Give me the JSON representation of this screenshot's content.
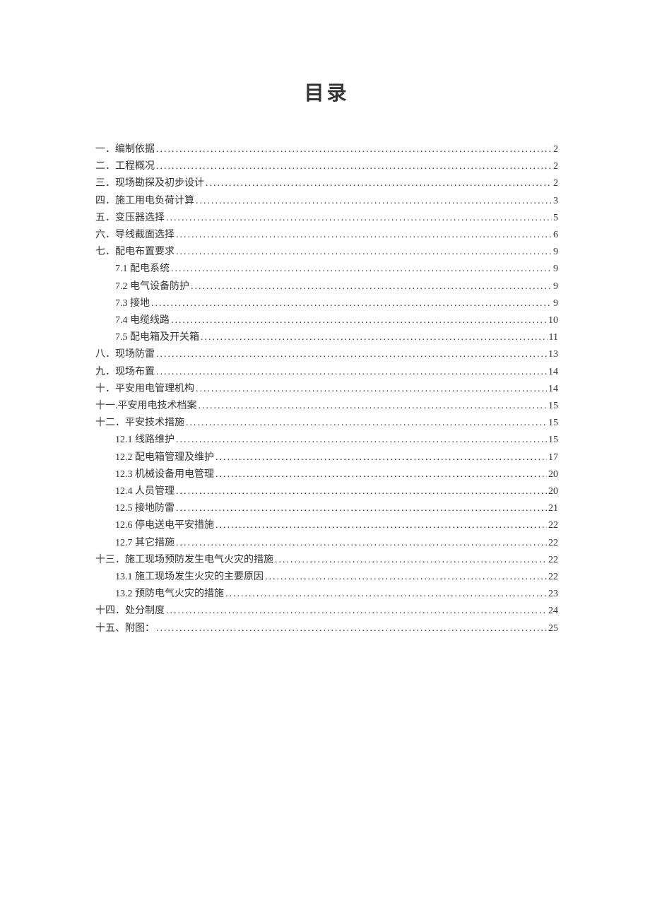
{
  "title": "目录",
  "entries": [
    {
      "label": "一．编制依据 ",
      "page": "2",
      "sub": false
    },
    {
      "label": "二．工程概况 ",
      "page": "2",
      "sub": false
    },
    {
      "label": "三．现场勘探及初步设计 ",
      "page": "2",
      "sub": false
    },
    {
      "label": "四．施工用电负荷计算 ",
      "page": "3",
      "sub": false
    },
    {
      "label": "五．变压器选择 ",
      "page": "5",
      "sub": false
    },
    {
      "label": "六．导线截面选择 ",
      "page": "6",
      "sub": false
    },
    {
      "label": "七．配电布置要求 ",
      "page": "9",
      "sub": false
    },
    {
      "label": "7.1 配电系统 ",
      "page": "9",
      "sub": true
    },
    {
      "label": "7.2 电气设备防护 ",
      "page": "9",
      "sub": true
    },
    {
      "label": "7.3 接地 ",
      "page": "9",
      "sub": true
    },
    {
      "label": "7.4 电缆线路 ",
      "page": "10",
      "sub": true
    },
    {
      "label": "7.5 配电箱及开关箱 ",
      "page": "11",
      "sub": true
    },
    {
      "label": "八．现场防雷 ",
      "page": "13",
      "sub": false
    },
    {
      "label": "九．现场布置 ",
      "page": "14",
      "sub": false
    },
    {
      "label": "十．平安用电管理机构 ",
      "page": "14",
      "sub": false
    },
    {
      "label": "十一.平安用电技术档案 ",
      "page": "15",
      "sub": false
    },
    {
      "label": "十二．平安技术措施 ",
      "page": "15",
      "sub": false
    },
    {
      "label": "12.1 线路维护 ",
      "page": "15",
      "sub": true
    },
    {
      "label": "12.2 配电箱管理及维护 ",
      "page": "17",
      "sub": true
    },
    {
      "label": "12.3 机械设备用电管理 ",
      "page": "20",
      "sub": true
    },
    {
      "label": "12.4 人员管理 ",
      "page": "20",
      "sub": true
    },
    {
      "label": "12.5 接地防雷 ",
      "page": "21",
      "sub": true
    },
    {
      "label": "12.6  停电送电平安措施 ",
      "page": "22",
      "sub": true
    },
    {
      "label": "12.7 其它措施 ",
      "page": "22",
      "sub": true
    },
    {
      "label": "十三．施工现场预防发生电气火灾的措施 ",
      "page": "22",
      "sub": false
    },
    {
      "label": "13.1 施工现场发生火灾的主要原因",
      "page": "22",
      "sub": true
    },
    {
      "label": "13.2 预防电气火灾的措施",
      "page": "23",
      "sub": true
    },
    {
      "label": "十四．处分制度 ",
      "page": "24",
      "sub": false
    },
    {
      "label": "十五、附图： ",
      "page": "25",
      "sub": false
    }
  ]
}
